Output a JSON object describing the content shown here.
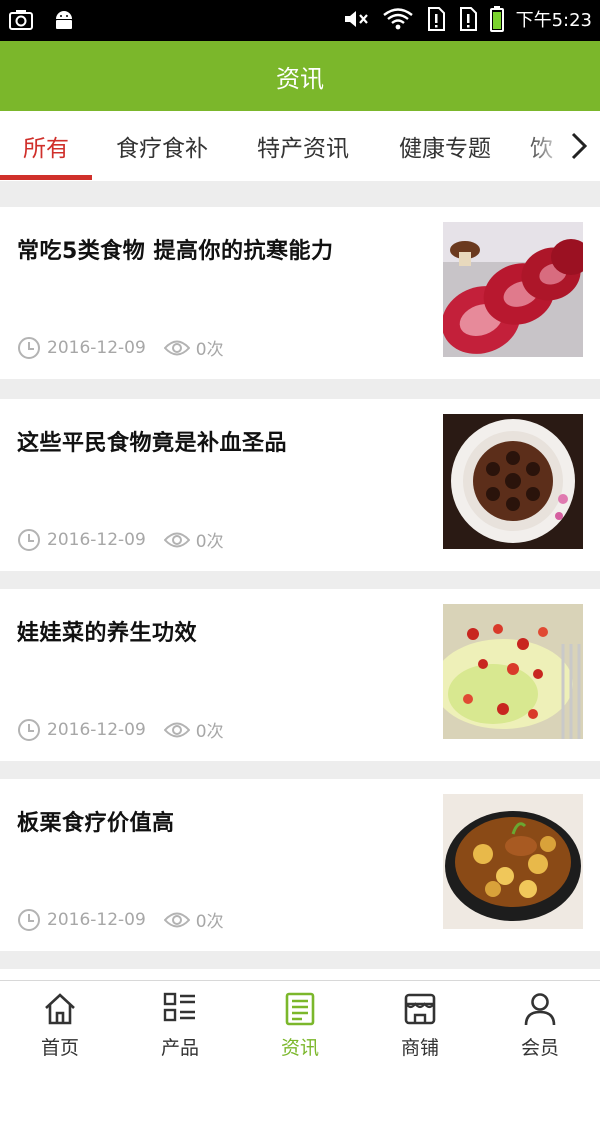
{
  "status_bar": {
    "time": "下午5:23",
    "icons": [
      "screenshot-icon",
      "android-icon",
      "mute-icon",
      "wifi-icon",
      "sim1-icon",
      "sim2-icon",
      "battery-icon"
    ]
  },
  "header": {
    "title": "资讯"
  },
  "tabs": [
    {
      "label": "所有",
      "active": true
    },
    {
      "label": "食疗食补",
      "active": false
    },
    {
      "label": "特产资讯",
      "active": false
    },
    {
      "label": "健康专题",
      "active": false
    },
    {
      "label": "饮",
      "active": false
    }
  ],
  "articles": [
    {
      "title": "常吃5类食物 提高你的抗寒能力",
      "date": "2016-12-09",
      "views": "0次",
      "image": "raw-beef-slices"
    },
    {
      "title": "这些平民食物竟是补血圣品",
      "date": "2016-12-09",
      "views": "0次",
      "image": "lotus-root-dish"
    },
    {
      "title": "娃娃菜的养生功效",
      "date": "2016-12-09",
      "views": "0次",
      "image": "baby-cabbage-chili"
    },
    {
      "title": "板栗食疗价值高",
      "date": "2016-12-09",
      "views": "0次",
      "image": "chestnut-chicken-pot"
    }
  ],
  "bottom_nav": [
    {
      "label": "首页",
      "icon": "home-icon",
      "active": false
    },
    {
      "label": "产品",
      "icon": "product-grid-icon",
      "active": false
    },
    {
      "label": "资讯",
      "icon": "news-icon",
      "active": true
    },
    {
      "label": "商铺",
      "icon": "shop-icon",
      "active": false
    },
    {
      "label": "会员",
      "icon": "member-icon",
      "active": false
    }
  ],
  "colors": {
    "brand_green": "#7bb72b",
    "active_tab_red": "#d0302b",
    "meta_gray": "#a7a7a7",
    "background": "#ededed"
  }
}
